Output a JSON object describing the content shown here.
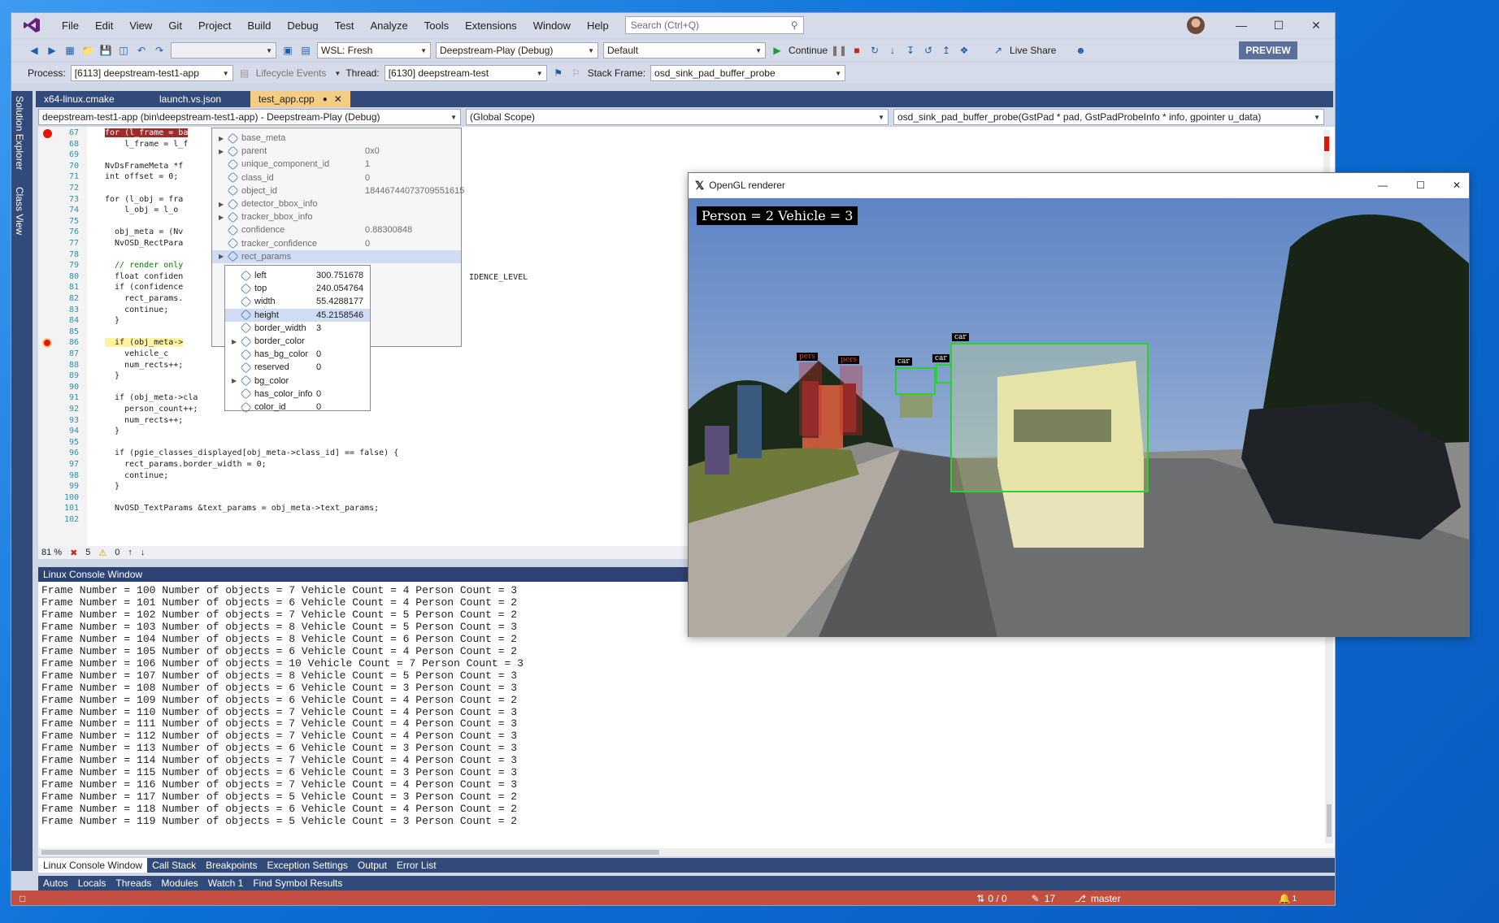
{
  "menu": {
    "items": [
      "File",
      "Edit",
      "View",
      "Git",
      "Project",
      "Build",
      "Debug",
      "Test",
      "Analyze",
      "Tools",
      "Extensions",
      "Window",
      "Help"
    ],
    "search_placeholder": "Search (Ctrl+Q)"
  },
  "toolbar": {
    "wsl": "WSL: Fresh",
    "config": "Deepstream-Play (Debug)",
    "platform": "Default",
    "continue": "Continue",
    "live_share": "Live Share",
    "preview": "PREVIEW"
  },
  "toolbar2": {
    "process_label": "Process:",
    "process": "[6113] deepstream-test1-app",
    "lifecycle": "Lifecycle Events",
    "thread_label": "Thread:",
    "thread": "[6130] deepstream-test",
    "frame_label": "Stack Frame:",
    "frame": "osd_sink_pad_buffer_probe"
  },
  "sidebar": {
    "solution_explorer": "Solution Explorer",
    "class_view": "Class View"
  },
  "tabs": [
    "x64-linux.cmake",
    "launch.vs.json",
    "test_app.cpp"
  ],
  "nav": {
    "project": "deepstream-test1-app (bin\\deepstream-test1-app) - Deepstream-Play (Debug)",
    "scope": "(Global Scope)",
    "function": "osd_sink_pad_buffer_probe(GstPad * pad, GstPadProbeInfo * info, gpointer u_data)"
  },
  "code": [
    {
      "n": "67",
      "t": "for (l_frame = ba"
    },
    {
      "n": "68",
      "t": "    l_frame = l_f"
    },
    {
      "n": "69",
      "t": ""
    },
    {
      "n": "70",
      "t": "NvDsFrameMeta *f"
    },
    {
      "n": "71",
      "t": "int offset = 0;"
    },
    {
      "n": "72",
      "t": ""
    },
    {
      "n": "73",
      "t": "for (l_obj = fra"
    },
    {
      "n": "74",
      "t": "    l_obj = l_o"
    },
    {
      "n": "75",
      "t": ""
    },
    {
      "n": "76",
      "t": "  obj_meta = (Nv"
    },
    {
      "n": "77",
      "t": "  NvOSD_RectPara"
    },
    {
      "n": "78",
      "t": ""
    },
    {
      "n": "79",
      "t": "  // render only"
    },
    {
      "n": "80",
      "t": "  float confiden"
    },
    {
      "n": "81",
      "t": "  if (confidence"
    },
    {
      "n": "82",
      "t": "    rect_params."
    },
    {
      "n": "83",
      "t": "    continue;"
    },
    {
      "n": "84",
      "t": "  }"
    },
    {
      "n": "85",
      "t": ""
    },
    {
      "n": "86",
      "t": "  if (obj_meta->"
    },
    {
      "n": "87",
      "t": "    vehicle_c"
    },
    {
      "n": "88",
      "t": "    num_rects++;"
    },
    {
      "n": "89",
      "t": "  }"
    },
    {
      "n": "90",
      "t": ""
    },
    {
      "n": "91",
      "t": "  if (obj_meta->cla"
    },
    {
      "n": "92",
      "t": "    person_count++;"
    },
    {
      "n": "93",
      "t": "    num_rects++;"
    },
    {
      "n": "94",
      "t": "  }"
    },
    {
      "n": "95",
      "t": ""
    },
    {
      "n": "96",
      "t": "  if (pgie_classes_displayed[obj_meta->class_id] == false) {"
    },
    {
      "n": "97",
      "t": "    rect_params.border_width = 0;"
    },
    {
      "n": "98",
      "t": "    continue;"
    },
    {
      "n": "99",
      "t": "  }"
    },
    {
      "n": "100",
      "t": ""
    },
    {
      "n": "101",
      "t": "  NvOSD_TextParams &text_params = obj_meta->text_params;"
    },
    {
      "n": "102",
      "t": ""
    }
  ],
  "code_tail": "IDENCE_LEVEL",
  "datatip": [
    {
      "name": "base_meta",
      "value": ""
    },
    {
      "name": "parent",
      "value": "0x0"
    },
    {
      "name": "unique_component_id",
      "value": "1"
    },
    {
      "name": "class_id",
      "value": "0"
    },
    {
      "name": "object_id",
      "value": "18446744073709551615"
    },
    {
      "name": "detector_bbox_info",
      "value": ""
    },
    {
      "name": "tracker_bbox_info",
      "value": ""
    },
    {
      "name": "confidence",
      "value": "0.88300848"
    },
    {
      "name": "tracker_confidence",
      "value": "0"
    },
    {
      "name": "rect_params",
      "value": ""
    }
  ],
  "datatip2": [
    {
      "name": "left",
      "value": "300.751678"
    },
    {
      "name": "top",
      "value": "240.054764"
    },
    {
      "name": "width",
      "value": "55.4288177"
    },
    {
      "name": "height",
      "value": "45.2158546"
    },
    {
      "name": "border_width",
      "value": "3"
    },
    {
      "name": "border_color",
      "value": ""
    },
    {
      "name": "has_bg_color",
      "value": "0"
    },
    {
      "name": "reserved",
      "value": "0"
    },
    {
      "name": "bg_color",
      "value": ""
    },
    {
      "name": "has_color_info",
      "value": "0"
    },
    {
      "name": "color_id",
      "value": "0"
    }
  ],
  "editor_status": {
    "zoom": "81 %",
    "errors": "5",
    "warnings": "0"
  },
  "console": {
    "title": "Linux Console Window",
    "lines": [
      "Frame Number = 100 Number of objects = 7 Vehicle Count = 4 Person Count = 3",
      "Frame Number = 101 Number of objects = 6 Vehicle Count = 4 Person Count = 2",
      "Frame Number = 102 Number of objects = 7 Vehicle Count = 5 Person Count = 2",
      "Frame Number = 103 Number of objects = 8 Vehicle Count = 5 Person Count = 3",
      "Frame Number = 104 Number of objects = 8 Vehicle Count = 6 Person Count = 2",
      "Frame Number = 105 Number of objects = 6 Vehicle Count = 4 Person Count = 2",
      "Frame Number = 106 Number of objects = 10 Vehicle Count = 7 Person Count = 3",
      "Frame Number = 107 Number of objects = 8 Vehicle Count = 5 Person Count = 3",
      "Frame Number = 108 Number of objects = 6 Vehicle Count = 3 Person Count = 3",
      "Frame Number = 109 Number of objects = 6 Vehicle Count = 4 Person Count = 2",
      "Frame Number = 110 Number of objects = 7 Vehicle Count = 4 Person Count = 3",
      "Frame Number = 111 Number of objects = 7 Vehicle Count = 4 Person Count = 3",
      "Frame Number = 112 Number of objects = 7 Vehicle Count = 4 Person Count = 3",
      "Frame Number = 113 Number of objects = 6 Vehicle Count = 3 Person Count = 3",
      "Frame Number = 114 Number of objects = 7 Vehicle Count = 4 Person Count = 3",
      "Frame Number = 115 Number of objects = 6 Vehicle Count = 3 Person Count = 3",
      "Frame Number = 116 Number of objects = 7 Vehicle Count = 4 Person Count = 3",
      "Frame Number = 117 Number of objects = 5 Vehicle Count = 3 Person Count = 2",
      "Frame Number = 118 Number of objects = 6 Vehicle Count = 4 Person Count = 2",
      "Frame Number = 119 Number of objects = 5 Vehicle Count = 3 Person Count = 2"
    ]
  },
  "bottom_tabs": [
    "Linux Console Window",
    "Call Stack",
    "Breakpoints",
    "Exception Settings",
    "Output",
    "Error List"
  ],
  "bottom_tabs2": [
    "Autos",
    "Locals",
    "Threads",
    "Modules",
    "Watch 1",
    "Find Symbol Results"
  ],
  "status": {
    "changes": "0 / 0",
    "edits": "17",
    "branch": "master",
    "notifications": "1"
  },
  "renderer": {
    "title": "OpenGL renderer",
    "osd": "Person = 2 Vehicle = 3",
    "labels": {
      "car": "car",
      "person": "pers"
    }
  },
  "colors": {
    "vs_frame": "#cfd6e5",
    "status_bar": "#c24f3f",
    "bbox": "#2bd12b"
  }
}
